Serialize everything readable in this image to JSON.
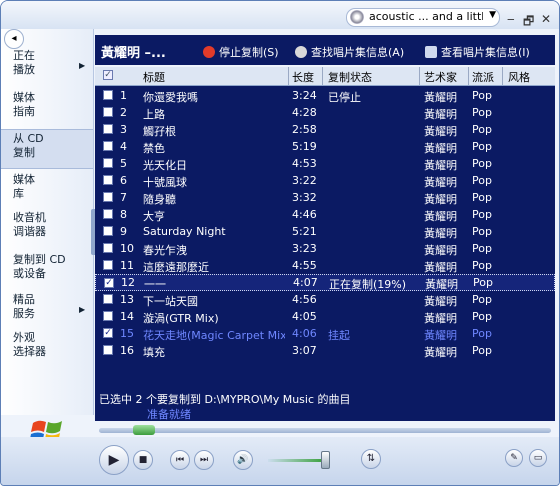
{
  "titlebar": {
    "now_playing": "acoustic ... and a little r",
    "minimize": "‒",
    "restore": "🗗",
    "close": "✕"
  },
  "nav": {
    "items": [
      {
        "label": "正在\n播放",
        "arrow": "▶"
      },
      {
        "label": "媒体\n指南",
        "arrow": ""
      },
      {
        "label": "从 CD\n复制",
        "arrow": ""
      },
      {
        "label": "媒体\n库",
        "arrow": ""
      },
      {
        "label": "收音机\n调谐器",
        "arrow": ""
      },
      {
        "label": "复制到 CD\n或设备",
        "arrow": ""
      },
      {
        "label": "精品\n服务",
        "arrow": "▶"
      },
      {
        "label": "外观\n选择器",
        "arrow": ""
      }
    ]
  },
  "header": {
    "album": "黃耀明 –...",
    "stop_copy": "停止复制(S)",
    "find_album": "查找唱片集信息(A)",
    "view_album": "查看唱片集信息(I)"
  },
  "columns": {
    "check": "✓",
    "title": "标题",
    "length": "长度",
    "status": "复制状态",
    "artist": "艺术家",
    "genre": "流派",
    "style": "风格"
  },
  "tracks": [
    {
      "n": "1",
      "title": "你還愛我嗎",
      "len": "3:24",
      "status": "已停止",
      "artist": "黃耀明",
      "genre": "Pop",
      "checked": false
    },
    {
      "n": "2",
      "title": "上路",
      "len": "4:28",
      "status": "",
      "artist": "黃耀明",
      "genre": "Pop",
      "checked": false
    },
    {
      "n": "3",
      "title": "觸孖根",
      "len": "2:58",
      "status": "",
      "artist": "黃耀明",
      "genre": "Pop",
      "checked": false
    },
    {
      "n": "4",
      "title": "禁色",
      "len": "5:19",
      "status": "",
      "artist": "黃耀明",
      "genre": "Pop",
      "checked": false
    },
    {
      "n": "5",
      "title": "光天化日",
      "len": "4:53",
      "status": "",
      "artist": "黃耀明",
      "genre": "Pop",
      "checked": false
    },
    {
      "n": "6",
      "title": "十號風球",
      "len": "3:22",
      "status": "",
      "artist": "黃耀明",
      "genre": "Pop",
      "checked": false
    },
    {
      "n": "7",
      "title": "隨身聽",
      "len": "3:32",
      "status": "",
      "artist": "黃耀明",
      "genre": "Pop",
      "checked": false
    },
    {
      "n": "8",
      "title": "大亨",
      "len": "4:46",
      "status": "",
      "artist": "黃耀明",
      "genre": "Pop",
      "checked": false
    },
    {
      "n": "9",
      "title": "Saturday Night",
      "len": "5:21",
      "status": "",
      "artist": "黃耀明",
      "genre": "Pop",
      "checked": false
    },
    {
      "n": "10",
      "title": "春光乍洩",
      "len": "3:23",
      "status": "",
      "artist": "黃耀明",
      "genre": "Pop",
      "checked": false
    },
    {
      "n": "11",
      "title": "這麼遠那麼近",
      "len": "4:55",
      "status": "",
      "artist": "黃耀明",
      "genre": "Pop",
      "checked": false
    },
    {
      "n": "12",
      "title": "一一",
      "len": "4:07",
      "status": "正在复制(19%)",
      "artist": "黃耀明",
      "genre": "Pop",
      "checked": true
    },
    {
      "n": "13",
      "title": "下一站天國",
      "len": "4:56",
      "status": "",
      "artist": "黃耀明",
      "genre": "Pop",
      "checked": false
    },
    {
      "n": "14",
      "title": "漩渦(GTR Mix)",
      "len": "4:05",
      "status": "",
      "artist": "黃耀明",
      "genre": "Pop",
      "checked": false
    },
    {
      "n": "15",
      "title": "花天走地(Magic Carpet Mix)",
      "len": "4:06",
      "status": "挂起",
      "artist": "黃耀明",
      "genre": "Pop",
      "checked": true
    },
    {
      "n": "16",
      "title": "填充",
      "len": "3:07",
      "status": "",
      "artist": "黃耀明",
      "genre": "Pop",
      "checked": false
    }
  ],
  "status": {
    "summary": "已选中 2 个要复制到 D:\\MYPRO\\My Music 的曲目",
    "state": "准备就绪"
  },
  "playback": {
    "position_fraction": 0.08,
    "volume_fraction": 0.95
  },
  "controls": {
    "play": "▶",
    "stop": "■",
    "prev": "⏮",
    "next": "⏭",
    "mute": "🔊",
    "shuffle": "⇅"
  }
}
